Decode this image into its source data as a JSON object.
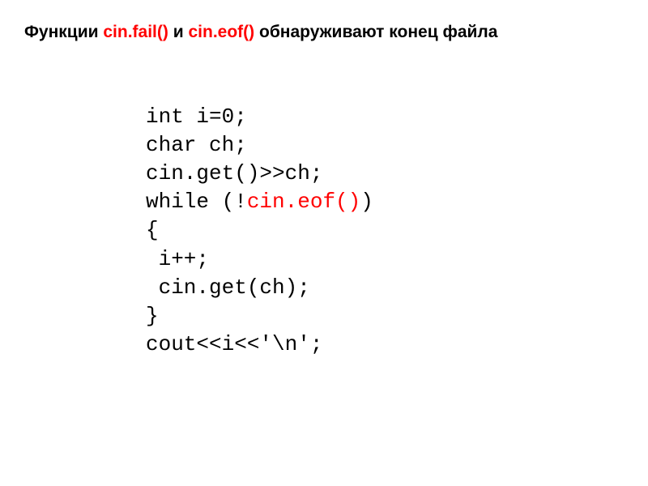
{
  "heading": {
    "prefix": "Функции ",
    "func1": "cin.fail()",
    "mid": " и ",
    "func2": "cin.eof()",
    "suffix": " обнаруживают конец файла"
  },
  "code": {
    "l1": "int i=0;",
    "l2": "char ch;",
    "l3": "cin.get()>>ch;",
    "l4a": "while (!",
    "l4b": "cin.eof()",
    "l4c": ")",
    "l5": "{",
    "l6": " i++;",
    "l7": " cin.get(ch);",
    "l8": "}",
    "l9": "cout<<i<<'\\n';"
  }
}
